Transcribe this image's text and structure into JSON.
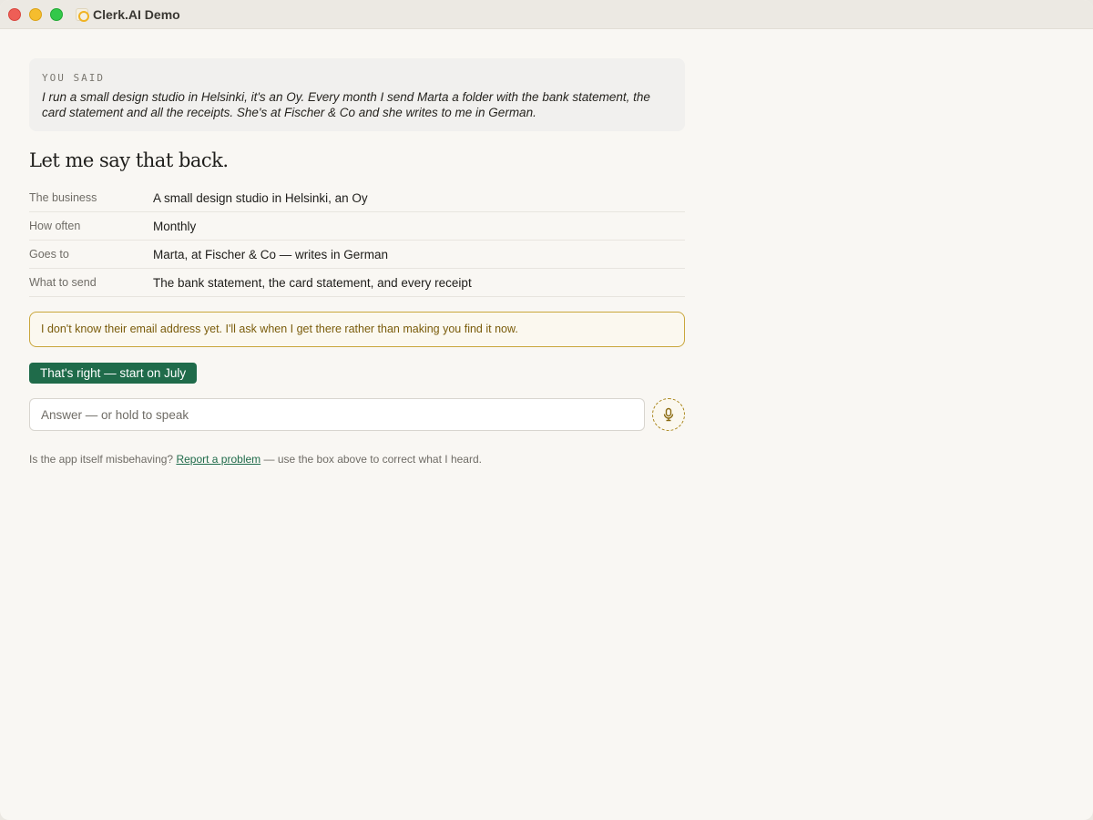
{
  "window": {
    "title": "Clerk.AI Demo"
  },
  "you_said": {
    "label": "YOU SAID",
    "text": "I run a small design studio in Helsinki, it's an Oy. Every month I send Marta a folder with the bank statement, the card statement and all the receipts. She's at Fischer & Co and she writes to me in German."
  },
  "heading": "Let me say that back.",
  "summary": [
    {
      "label": "The business",
      "value": "A small design studio in Helsinki, an Oy"
    },
    {
      "label": "How often",
      "value": "Monthly"
    },
    {
      "label": "Goes to",
      "value": "Marta, at Fischer & Co — writes in German"
    },
    {
      "label": "What to send",
      "value": "The bank statement, the card statement, and every receipt"
    }
  ],
  "notice": "I don't know their email address yet. I'll ask when I get there rather than making you find it now.",
  "confirm_button": "That's right — start on July",
  "answer": {
    "placeholder": "Answer — or hold to speak",
    "value": ""
  },
  "mic_icon": "microphone-icon",
  "footer": {
    "prefix": "Is the app itself misbehaving?",
    "link": "Report a problem",
    "suffix": "— use the box above to correct what I heard."
  },
  "colors": {
    "accent_green": "#1f6b4a",
    "notice_border": "#c9a63b",
    "notice_text": "#7a5c0b"
  }
}
